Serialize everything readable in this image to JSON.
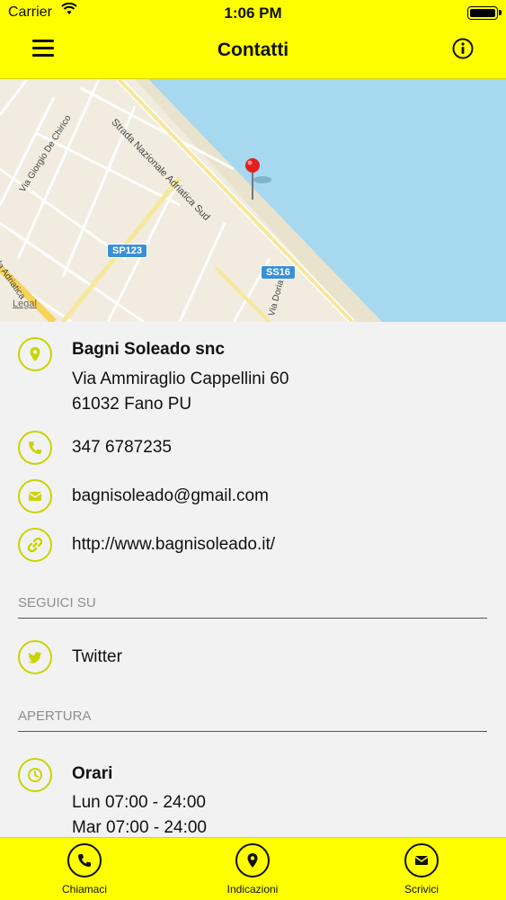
{
  "status_bar": {
    "carrier": "Carrier",
    "time": "1:06 PM"
  },
  "nav": {
    "title": "Contatti",
    "menu_icon": "hamburger-icon",
    "info_icon": "info-icon"
  },
  "map": {
    "labels": {
      "road_1": "Strada Nazionale Adriatica Sud",
      "road_2": "Via Giorgio De Chirico",
      "road_3": "Via Doria",
      "road_4": "da Adriatica"
    },
    "badges": {
      "sp": "SP123",
      "ss": "SS16"
    },
    "legal": "Legal"
  },
  "contact": {
    "name": "Bagni Soleado snc",
    "address_line1": "Via Ammiraglio Cappellini 60",
    "address_line2": "61032 Fano PU",
    "phone": "347 6787235",
    "email": "bagnisoleado@gmail.com",
    "website": "http://www.bagnisoleado.it/"
  },
  "social": {
    "header": "SEGUICI SU",
    "twitter": "Twitter"
  },
  "opening": {
    "header": "APERTURA",
    "title": "Orari",
    "hours": [
      "Lun 07:00 - 24:00",
      "Mar 07:00 - 24:00"
    ]
  },
  "tabs": [
    {
      "label": "Chiamaci",
      "icon": "phone-icon"
    },
    {
      "label": "Indicazioni",
      "icon": "map-pin-icon"
    },
    {
      "label": "Scrivici",
      "icon": "envelope-icon"
    }
  ],
  "colors": {
    "accent": "#ffff00",
    "icon_outline": "#c9d400",
    "sea": "#a6d8ef",
    "land": "#f1ecdf"
  }
}
